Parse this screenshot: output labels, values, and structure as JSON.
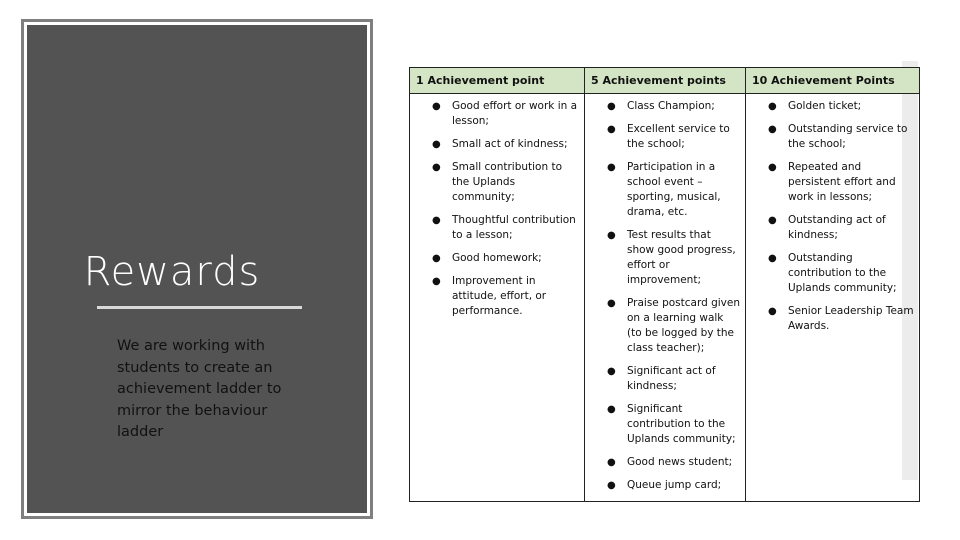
{
  "slide": {
    "title": "Rewards",
    "subtitle": "We are working with students to create an achievement ladder to mirror the behaviour ladder"
  },
  "colors": {
    "panel_fill": "#535353",
    "panel_border": "#7f7f7f",
    "header_fill": "#d3e5c4",
    "rule": "#d9d9d9"
  },
  "table": {
    "headers": [
      "1 Achievement point",
      "5 Achievement points",
      "10 Achievement Points"
    ],
    "columns": [
      [
        "Good effort or work in a lesson;",
        "Small act of kindness;",
        "Small contribution to the Uplands community;",
        "Thoughtful contribution to a lesson;",
        "Good homework;",
        "Improvement in attitude, effort, or performance."
      ],
      [
        "Class Champion;",
        "Excellent service to the school;",
        "Participation in a school event – sporting, musical, drama, etc.",
        "Test results that show good progress, effort or improvement;",
        "Praise postcard given on a learning walk (to be logged by the class teacher);",
        "Significant act of kindness;",
        "Significant contribution to the Uplands community;",
        "Good news student;",
        "Queue jump card;"
      ],
      [
        "Golden ticket;",
        "Outstanding service to the school;",
        "Repeated and persistent effort and work in lessons;",
        "Outstanding act of kindness;",
        "Outstanding contribution to the Uplands community;",
        "Senior Leadership Team Awards."
      ]
    ],
    "bullet_glyph": "●"
  }
}
